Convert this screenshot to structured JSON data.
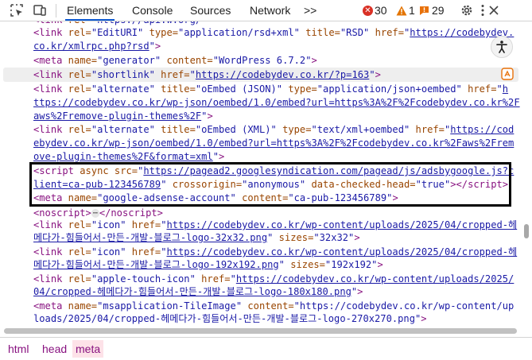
{
  "toolbar": {
    "tabs": [
      {
        "label": "Elements",
        "active": true
      },
      {
        "label": "Console"
      },
      {
        "label": "Sources"
      },
      {
        "label": "Network"
      }
    ],
    "more_tabs": ">>",
    "errors": "30",
    "warnings": "1",
    "issues": "29",
    "icons": [
      "inspect-icon",
      "device-toggle-icon",
      "more-tabs-icon",
      "gear-icon",
      "kebab-menu-icon",
      "close-icon"
    ]
  },
  "colors": {
    "tag": "#881280",
    "attr_name": "#994500",
    "attr_value": "#1a1aa6",
    "error": "#d93025",
    "warning": "#e37400",
    "issue": "#e8710a",
    "active_tab": "#0b57d0",
    "selected_crumb_bg": "#fde2e8"
  },
  "code": {
    "l0": {
      "a": "<",
      "b": "link",
      "c": " rel=",
      "d": "\"EditURI\"",
      "e": " type=",
      "f": "\"application/rsd+xml\"",
      "g": " title=",
      "h": "\"RSD\"",
      "i": " href=",
      "j": "\"",
      "k": "https://codebydev."
    },
    "l1": {
      "k": "co.kr/xmlrpc.php?rsd",
      "j": "\"",
      "t": ">"
    },
    "l2": {
      "a": "<",
      "b": "meta",
      "c": " name=",
      "d": "\"generator\"",
      "e": " content=",
      "f": "\"WordPress 6.7.2\"",
      "t": ">"
    },
    "l3": {
      "a": "<",
      "b": "link",
      "c": " rel=",
      "d": "\"shortlink\"",
      "e": " href=",
      "j": "\"",
      "k": "https://codebydev.co.kr/?p=163",
      "j2": "\"",
      "t": ">"
    },
    "l4": {
      "a": "<",
      "b": "link",
      "c": " rel=",
      "d": "\"alternate\"",
      "e": " title=",
      "f": "\"oEmbed (JSON)\"",
      "g": " type=",
      "h": "\"application/json+oembed\"",
      "i": " href=",
      "j": "\"",
      "k": "h"
    },
    "l5": {
      "k": "ttps://codebydev.co.kr/wp-json/oembed/1.0/embed?url=https%3A%2F%2Fcodebydev.co.kr%2F"
    },
    "l6": {
      "k": "aws%2Fremove-plugin-themes%2F",
      "j": "\"",
      "t": ">"
    },
    "l7": {
      "a": "<",
      "b": "link",
      "c": " rel=",
      "d": "\"alternate\"",
      "e": " title=",
      "f": "\"oEmbed (XML)\"",
      "g": " type=",
      "h": "\"text/xml+oembed\"",
      "i": " href=",
      "j": "\"",
      "k": "https://cod"
    },
    "l8": {
      "k": "ebydev.co.kr/wp-json/oembed/1.0/embed?url=https%3A%2F%2Fcodebydev.co.kr%2Faws%2Frem"
    },
    "l9": {
      "k": "ove-plugin-themes%2F&format=xml",
      "j": "\"",
      "t": ">"
    },
    "l10": {
      "a": "<",
      "b": "script",
      "c": " async src=",
      "j": "\"",
      "k": "https://pagead2.googlesyndication.com/pagead/js/adsbygoogle.js?c"
    },
    "l11": {
      "k": "lient=ca-pub-123456789",
      "j": "\"",
      "e": " crossorigin=",
      "f": "\"anonymous\"",
      "g": " data-checked-head=",
      "h": "\"true\"",
      "t": "></",
      "b": "script",
      "t2": ">"
    },
    "l12": {
      "a": "<",
      "b": "meta",
      "c": " name=",
      "d": "\"google-adsense-account\"",
      "e": " content=",
      "f": "\"ca-pub-123456789\"",
      "t": ">"
    },
    "l13": {
      "a": "<",
      "b": "noscript",
      "t": ">",
      "ell": "⋯",
      "a2": "</",
      "b2": "noscript",
      "t2": ">"
    },
    "l14": {
      "a": "<",
      "b": "link",
      "c": " rel=",
      "d": "\"icon\"",
      "e": " href=",
      "j": "\"",
      "k": "https://codebydev.co.kr/wp-content/uploads/2025/04/cropped-헤"
    },
    "l15": {
      "k": "메다가-힘들어서-만든-개발-블로그-logo-32x32.png",
      "j": "\"",
      "g": " sizes=",
      "h": "\"32x32\"",
      "t": ">"
    },
    "l16": {
      "a": "<",
      "b": "link",
      "c": " rel=",
      "d": "\"icon\"",
      "e": " href=",
      "j": "\"",
      "k": "https://codebydev.co.kr/wp-content/uploads/2025/04/cropped-헤"
    },
    "l17": {
      "k": "메다가-힘들어서-만든-개발-블로그-logo-192x192.png",
      "j": "\"",
      "g": " sizes=",
      "h": "\"192x192\"",
      "t": ">"
    },
    "l18": {
      "a": "<",
      "b": "link",
      "c": " rel=",
      "d": "\"apple-touch-icon\"",
      "e": " href=",
      "j": "\"",
      "k": "https://codebydev.co.kr/wp-content/uploads/2025/"
    },
    "l19": {
      "k": "04/cropped-헤메다가-힘들어서-만든-개발-블로그-logo-180x180.png",
      "j": "\"",
      "t": ">"
    },
    "l20": {
      "a": "<",
      "b": "meta",
      "c": " name=",
      "d": "\"msapplication-TileImage\"",
      "e": " content=",
      "f": "\"https://codebydev.co.kr/wp-content/up"
    },
    "l21": {
      "f": "loads/2025/04/cropped-헤메다가-힘들어서-만든-개발-블로그-logo-270x270.png\"",
      "t": ">"
    }
  },
  "breadcrumbs": [
    {
      "label": "html"
    },
    {
      "label": "head"
    },
    {
      "label": "meta",
      "selected": true
    }
  ]
}
